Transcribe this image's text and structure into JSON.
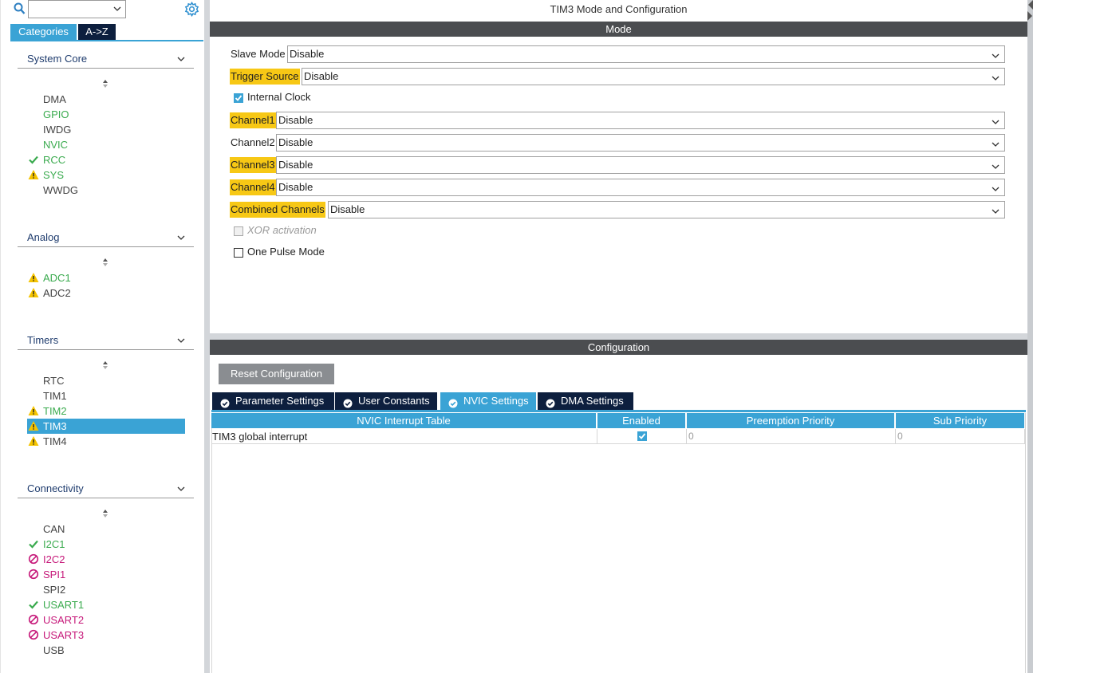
{
  "left_panel": {
    "search": {
      "value": ""
    },
    "tabs": {
      "categories": "Categories",
      "az": "A->Z"
    },
    "categories": [
      {
        "name": "System Core",
        "items": [
          {
            "label": "DMA",
            "status": "none",
            "color": "dark"
          },
          {
            "label": "GPIO",
            "status": "none",
            "color": "green"
          },
          {
            "label": "IWDG",
            "status": "none",
            "color": "dark"
          },
          {
            "label": "NVIC",
            "status": "none",
            "color": "green"
          },
          {
            "label": "RCC",
            "status": "check",
            "color": "green"
          },
          {
            "label": "SYS",
            "status": "warning",
            "color": "green"
          },
          {
            "label": "WWDG",
            "status": "none",
            "color": "dark"
          }
        ]
      },
      {
        "name": "Analog",
        "items": [
          {
            "label": "ADC1",
            "status": "warning",
            "color": "green"
          },
          {
            "label": "ADC2",
            "status": "warning",
            "color": "dark"
          }
        ]
      },
      {
        "name": "Timers",
        "items": [
          {
            "label": "RTC",
            "status": "none",
            "color": "dark"
          },
          {
            "label": "TIM1",
            "status": "none",
            "color": "dark"
          },
          {
            "label": "TIM2",
            "status": "warning",
            "color": "green"
          },
          {
            "label": "TIM3",
            "status": "warning",
            "color": "selected",
            "selected": true
          },
          {
            "label": "TIM4",
            "status": "warning",
            "color": "dark"
          }
        ]
      },
      {
        "name": "Connectivity",
        "items": [
          {
            "label": "CAN",
            "status": "none",
            "color": "dark"
          },
          {
            "label": "I2C1",
            "status": "check",
            "color": "green"
          },
          {
            "label": "I2C2",
            "status": "blocked",
            "color": "magenta"
          },
          {
            "label": "SPI1",
            "status": "blocked",
            "color": "magenta"
          },
          {
            "label": "SPI2",
            "status": "none",
            "color": "dark"
          },
          {
            "label": "USART1",
            "status": "check",
            "color": "green"
          },
          {
            "label": "USART2",
            "status": "blocked",
            "color": "magenta"
          },
          {
            "label": "USART3",
            "status": "blocked",
            "color": "magenta"
          },
          {
            "label": "USB",
            "status": "none",
            "color": "dark"
          }
        ]
      }
    ]
  },
  "main": {
    "title": "TIM3 Mode and Configuration",
    "mode_header": "Mode",
    "mode_fields": [
      {
        "label": "Slave Mode",
        "value": "Disable",
        "highlight": false
      },
      {
        "label": "Trigger Source",
        "value": "Disable",
        "highlight": true
      },
      {
        "label": "Channel1",
        "value": "Disable",
        "highlight": true
      },
      {
        "label": "Channel2",
        "value": "Disable",
        "highlight": false
      },
      {
        "label": "Channel3",
        "value": "Disable",
        "highlight": true
      },
      {
        "label": "Channel4",
        "value": "Disable",
        "highlight": true
      },
      {
        "label": "Combined Channels",
        "value": "Disable",
        "highlight": true
      }
    ],
    "internal_clock": {
      "label": "Internal Clock",
      "checked": true
    },
    "xor_activation": {
      "label": "XOR activation",
      "checked": false,
      "disabled": true
    },
    "one_pulse": {
      "label": "One Pulse Mode",
      "checked": false
    },
    "config_header": "Configuration",
    "reset_button": "Reset Configuration",
    "config_tabs": [
      {
        "label": "Parameter Settings",
        "active": false
      },
      {
        "label": "User Constants",
        "active": false
      },
      {
        "label": "NVIC Settings",
        "active": true
      },
      {
        "label": "DMA Settings",
        "active": false
      }
    ],
    "nvic_table": {
      "columns": [
        "NVIC Interrupt Table",
        "Enabled",
        "Preemption Priority",
        "Sub Priority"
      ],
      "rows": [
        {
          "name": "TIM3 global interrupt",
          "enabled": true,
          "preemption": "0",
          "sub": "0"
        }
      ]
    }
  },
  "colors": {
    "accent": "#3aa3d5",
    "navy": "#0d1f3e",
    "highlight": "#f7c815",
    "green": "#3bab4f",
    "magenta": "#c6197a",
    "warning": "#f5c400",
    "header_bar": "#4b4d50"
  }
}
